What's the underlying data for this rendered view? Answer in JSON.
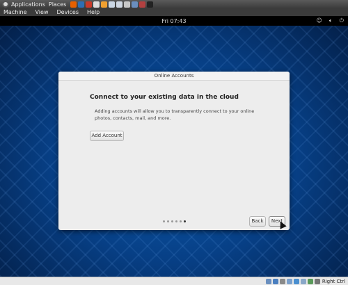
{
  "host_panel": {
    "applications_label": "Applications",
    "places_label": "Places",
    "launchers": [
      {
        "name": "firefox-icon",
        "color": "#e66000"
      },
      {
        "name": "thunderbird-icon",
        "color": "#2f6fb3"
      },
      {
        "name": "tools-icon",
        "color": "#c83a2a"
      },
      {
        "name": "editor-icon",
        "color": "#ddd"
      },
      {
        "name": "folder-icon",
        "color": "#f0a030"
      },
      {
        "name": "image-viewer-icon",
        "color": "#cbd7e5"
      },
      {
        "name": "mail-icon",
        "color": "#cfd7e2"
      },
      {
        "name": "calculator-icon",
        "color": "#c8c8c8"
      },
      {
        "name": "virtualbox-icon",
        "color": "#6a8fbf"
      },
      {
        "name": "app-icon",
        "color": "#b24040"
      },
      {
        "name": "terminal-icon",
        "color": "#222"
      }
    ]
  },
  "vm_menubar": {
    "items": [
      "Machine",
      "View",
      "Devices",
      "Help"
    ]
  },
  "guest_topbar": {
    "clock": "Fri 07:43"
  },
  "dialog": {
    "title": "Online Accounts",
    "heading": "Connect to your existing data in the cloud",
    "description": "Adding accounts will allow you to transparently connect to your online photos, contacts, mail, and more.",
    "add_account_label": "Add Account",
    "back_label": "Back",
    "next_label": "Next",
    "pages_total": 6,
    "current_page": 6
  },
  "statusbar": {
    "host_key": "Right Ctrl"
  }
}
